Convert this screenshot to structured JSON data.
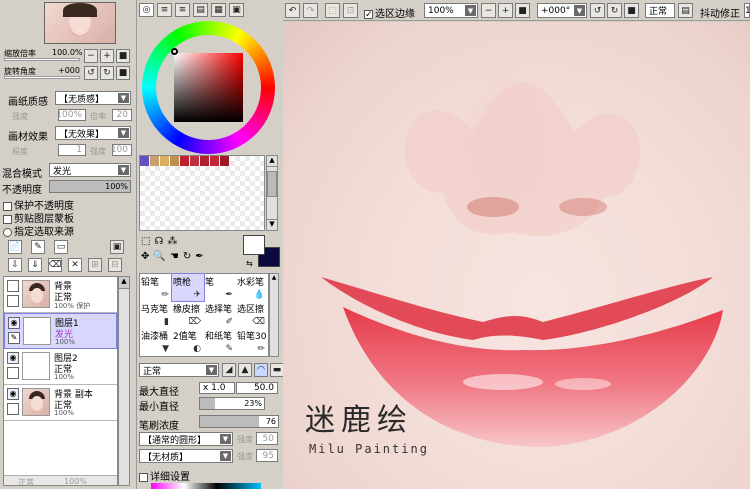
{
  "navigator": {
    "zoom_label": "缩放倍率",
    "zoom_value": "100.0%",
    "rotate_label": "旋转角度",
    "rotate_value": "+000"
  },
  "paper": {
    "texture_label": "画纸质感",
    "texture_value": "【无质感】",
    "strength_label": "强度",
    "strength_value": "100%",
    "scale_label": "倍率",
    "scale_value": "20"
  },
  "material": {
    "label": "画材效果",
    "value": "【无效果】",
    "size_label": "程度",
    "size_value": "1",
    "strength_label": "强度",
    "strength_value": "100"
  },
  "blend": {
    "label": "混合模式",
    "value": "发光",
    "opacity_label": "不透明度",
    "opacity_value": "100%",
    "opacity_fill": 1.0
  },
  "checks": [
    {
      "label": "保护不透明度",
      "checked": false
    },
    {
      "label": "剪贴图层蒙板",
      "checked": false
    },
    {
      "label": "指定选取来源",
      "checked": false
    }
  ],
  "layers": [
    {
      "name": "背景",
      "mode": "正常",
      "opacity": "100% 保护",
      "has_image": true,
      "selected": false
    },
    {
      "name": "图层1",
      "mode": "发光",
      "opacity": "100%",
      "has_image": false,
      "selected": true
    },
    {
      "name": "图层2",
      "mode": "正常",
      "opacity": "100%",
      "has_image": false,
      "selected": false
    },
    {
      "name": "背景 副本",
      "mode": "正常",
      "opacity": "100%",
      "has_image": true,
      "selected": false
    }
  ],
  "bottom_left": {
    "mode": "正常",
    "opacity": "100%"
  },
  "palette_colors": [
    "#6050c0",
    "#c8a070",
    "#d8b060",
    "#c09050",
    "#c02030",
    "#c03040",
    "#b02030",
    "#c02838",
    "#a01828"
  ],
  "tools": [
    {
      "label": "铅笔",
      "sel": false
    },
    {
      "label": "喷枪",
      "sel": true
    },
    {
      "label": "笔",
      "sel": false
    },
    {
      "label": "水彩笔",
      "sel": false
    },
    {
      "label": "马克笔",
      "sel": false
    },
    {
      "label": "橡皮擦",
      "sel": false
    },
    {
      "label": "选择笔",
      "sel": false
    },
    {
      "label": "选区擦",
      "sel": false
    },
    {
      "label": "油漆桶",
      "sel": false
    },
    {
      "label": "2值笔",
      "sel": false
    },
    {
      "label": "和纸笔",
      "sel": false
    },
    {
      "label": "铅笔30",
      "sel": false
    }
  ],
  "brush": {
    "mode": "正常",
    "max_label": "最大直径",
    "max_mult": "x 1.0",
    "max_value": "50.0",
    "min_label": "最小直径",
    "min_value": "23%",
    "min_fill": 0.23,
    "density_label": "笔刷浓度",
    "density_value": "76",
    "density_fill": 0.76,
    "shape_value": "【通常的圆形】",
    "shape_strength": "50",
    "texture_value": "【无材质】",
    "texture_strength": "95",
    "detail_label": "详细设置"
  },
  "toolbar": {
    "select_edge_label": "选区边缘",
    "select_edge_checked": true,
    "zoom": "100%",
    "angle": "+000°",
    "mode": "正常",
    "stabilizer_label": "抖动修正",
    "stabilizer_value": "1"
  },
  "watermark": {
    "title": "迷鹿绘",
    "subtitle": "Milu Painting"
  }
}
